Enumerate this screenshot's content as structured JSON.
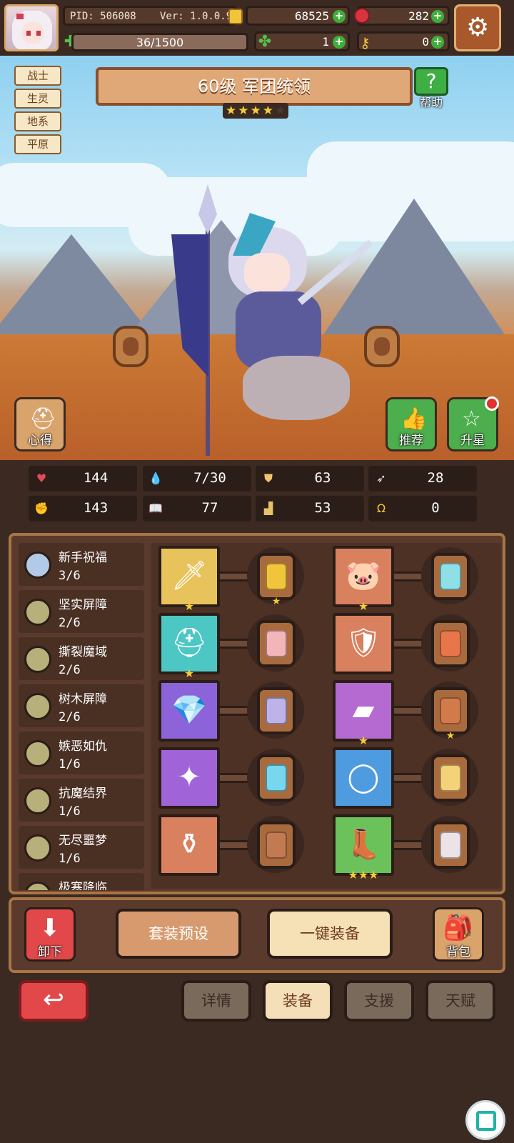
{
  "hud": {
    "pid": "PID: 506008",
    "version": "Ver: 1.0.0.9",
    "gold": "68525",
    "gems": "282",
    "energy": "36/1500",
    "clover": "1",
    "keys": "0"
  },
  "tags": [
    "战士",
    "生灵",
    "地系",
    "平原"
  ],
  "hero": {
    "title": "60级 军团统领",
    "stars_filled": 4,
    "stars_total": 5
  },
  "help_label": "帮助",
  "scene_buttons": {
    "notes": "心得",
    "recommend": "推荐",
    "star_up": "升星"
  },
  "stats": [
    {
      "icon": "heart-icon",
      "value": "144",
      "color": "#e24a5a",
      "symbol": "♥"
    },
    {
      "icon": "water-drop-icon",
      "value": "7/30",
      "color": "#7cc7ef",
      "symbol": "💧"
    },
    {
      "icon": "shield-icon",
      "value": "63",
      "color": "#f0c470",
      "symbol": "⛊"
    },
    {
      "icon": "wing-icon",
      "value": "28",
      "color": "#e9eef4",
      "symbol": "➶"
    },
    {
      "icon": "fist-icon",
      "value": "143",
      "color": "#e36b5a",
      "symbol": "✊"
    },
    {
      "icon": "book-icon",
      "value": "77",
      "color": "#87b7e8",
      "symbol": "📖"
    },
    {
      "icon": "boot-icon",
      "value": "53",
      "color": "#e7c26b",
      "symbol": "▟"
    },
    {
      "icon": "horseshoe-icon",
      "value": "0",
      "color": "#f1c23b",
      "symbol": "Ω"
    }
  ],
  "sets": [
    {
      "name": "新手祝福",
      "count": "3/6",
      "lit": true
    },
    {
      "name": "坚实屏障",
      "count": "2/6",
      "lit": false
    },
    {
      "name": "撕裂魔域",
      "count": "2/6",
      "lit": false
    },
    {
      "name": "树木屏障",
      "count": "2/6",
      "lit": false
    },
    {
      "name": "嫉恶如仇",
      "count": "1/6",
      "lit": false
    },
    {
      "name": "抗魔结界",
      "count": "1/6",
      "lit": false
    },
    {
      "name": "无尽噩梦",
      "count": "1/6",
      "lit": false
    },
    {
      "name": "极寒降临",
      "count": "",
      "lit": false
    }
  ],
  "equipment": [
    {
      "item": "sword-icon",
      "item_color": "#e8c25a",
      "item_stars": "★",
      "gem_color": "#f0c53b",
      "gem_stars": "★"
    },
    {
      "item": "pig-helmet-icon",
      "item_color": "#d9805e",
      "item_stars": "★",
      "gem_color": "#8ee0e6",
      "gem_stars": ""
    },
    {
      "item": "wooden-helmet-icon",
      "item_color": "#4cc7c4",
      "item_stars": "★",
      "gem_color": "#f3b5b8",
      "gem_stars": ""
    },
    {
      "item": "armor-icon",
      "item_color": "#d9805e",
      "item_stars": "",
      "gem_color": "#e8764a",
      "gem_stars": ""
    },
    {
      "item": "necklace-icon",
      "item_color": "#8c63d8",
      "item_stars": "",
      "gem_color": "#bdb3e8",
      "gem_stars": ""
    },
    {
      "item": "shield-plank-icon",
      "item_color": "#b46ad0",
      "item_stars": "★",
      "gem_color": "#d37a4a",
      "gem_stars": "★"
    },
    {
      "item": "crystal-ring-icon",
      "item_color": "#a064d8",
      "item_stars": "",
      "gem_color": "#76d7ef",
      "gem_stars": ""
    },
    {
      "item": "silver-ring-icon",
      "item_color": "#4f9be0",
      "item_stars": "",
      "gem_color": "#f4d27a",
      "gem_stars": ""
    },
    {
      "item": "urn-icon",
      "item_color": "#d9805e",
      "item_stars": "",
      "gem_color": "#c27a52",
      "gem_stars": ""
    },
    {
      "item": "boots-icon",
      "item_color": "#6cc25a",
      "item_stars": "★★★",
      "gem_color": "#ece3e6",
      "gem_stars": ""
    }
  ],
  "actions": {
    "unequip": "卸下",
    "preset": "套装预设",
    "auto_equip": "一键装备",
    "backpack": "背包"
  },
  "tabs": {
    "details": "详情",
    "equipment": "装备",
    "support": "支援",
    "talent": "天赋"
  }
}
